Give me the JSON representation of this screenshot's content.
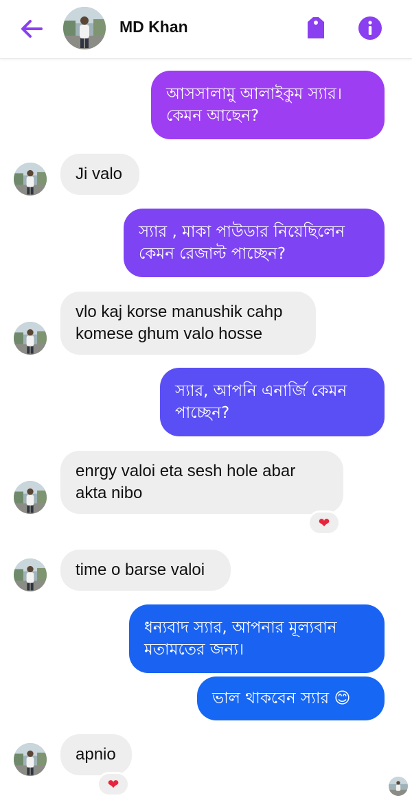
{
  "header": {
    "contact_name": "MD Khan",
    "back_icon": "arrow-left-icon",
    "tag_icon": "tag-icon",
    "info_icon": "info-icon",
    "accent_color": "#8a3ff0"
  },
  "messages": [
    {
      "side": "out",
      "lines": [
        "আসসালামু আলাইকুম স্যার।",
        "কেমন আছেন?"
      ],
      "color": "#9d3ef2"
    },
    {
      "side": "in",
      "lines": [
        "Ji valo"
      ]
    },
    {
      "side": "out",
      "lines": [
        "স্যার , মাকা পাউডার নিয়েছিলেন",
        "কেমন রেজাল্ট পাচ্ছেন?"
      ],
      "color": "#7e44f3"
    },
    {
      "side": "in",
      "lines": [
        "vlo kaj korse manushik cahp",
        "komese ghum valo hosse"
      ]
    },
    {
      "side": "out",
      "lines": [
        "স্যার, আপনি এনার্জি কেমন",
        "পাচ্ছেন?"
      ],
      "color": "#5a4ff4"
    },
    {
      "side": "in",
      "lines": [
        "enrgy valoi eta sesh hole abar",
        "akta nibo"
      ],
      "reaction": "❤"
    },
    {
      "side": "in",
      "lines": [
        "time o barse valoi"
      ]
    },
    {
      "side": "out",
      "lines": [
        "ধন্যবাদ স্যার,  আপনার মূল্যবান",
        "মতামতের জন্য।"
      ],
      "color": "#1a63f2"
    },
    {
      "side": "out",
      "lines": [
        "ভাল থাকবেন স্যার 😊"
      ],
      "color": "#1667f3"
    },
    {
      "side": "in",
      "lines": [
        "apnio"
      ],
      "reaction": "❤"
    }
  ]
}
